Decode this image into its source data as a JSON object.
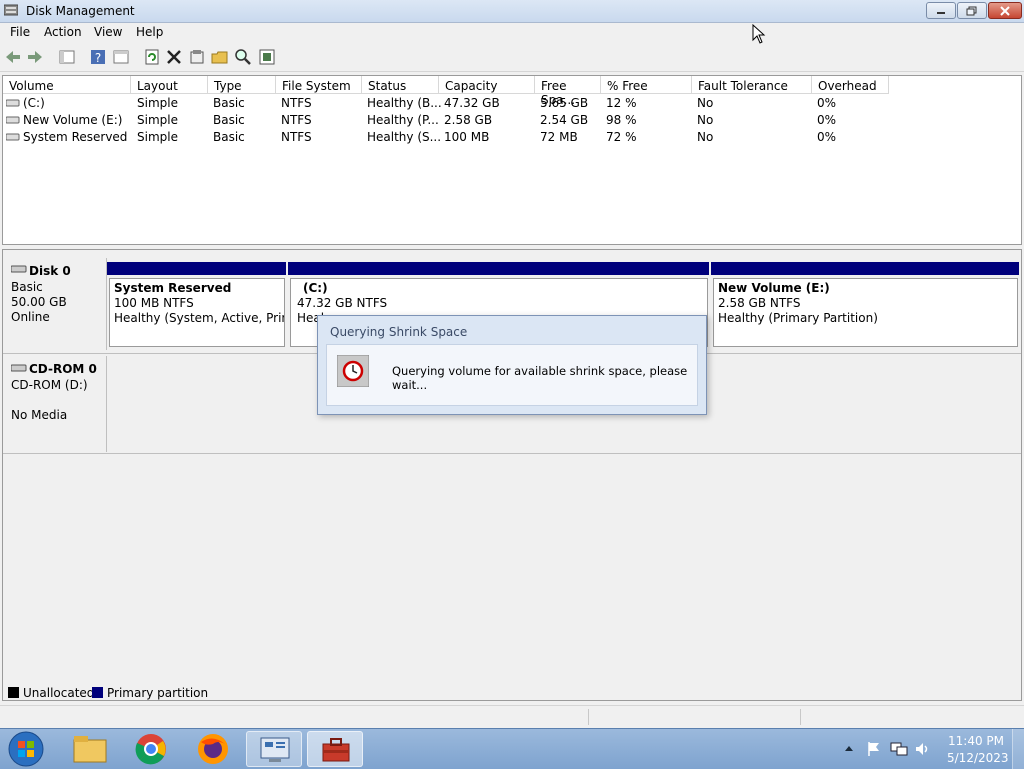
{
  "window": {
    "title": "Disk Management"
  },
  "menu": [
    "File",
    "Action",
    "View",
    "Help"
  ],
  "toolbar_icons": [
    "back-icon",
    "forward-icon",
    "console-icon",
    "help-icon",
    "properties-view-icon",
    "refresh-icon",
    "delete-icon",
    "properties-icon",
    "open-icon",
    "search-icon",
    "export-icon"
  ],
  "volume_table": {
    "columns": [
      "Volume",
      "Layout",
      "Type",
      "File System",
      "Status",
      "Capacity",
      "Free Spa...",
      "% Free",
      "Fault Tolerance",
      "Overhead"
    ],
    "rows": [
      [
        "(C:)",
        "Simple",
        "Basic",
        "NTFS",
        "Healthy (B...",
        "47.32 GB",
        "5.65 GB",
        "12 %",
        "No",
        "0%"
      ],
      [
        "New Volume (E:)",
        "Simple",
        "Basic",
        "NTFS",
        "Healthy (P...",
        "2.58 GB",
        "2.54 GB",
        "98 %",
        "No",
        "0%"
      ],
      [
        "System Reserved",
        "Simple",
        "Basic",
        "NTFS",
        "Healthy (S...",
        "100 MB",
        "72 MB",
        "72 %",
        "No",
        "0%"
      ]
    ]
  },
  "disks": {
    "disk0": {
      "name": "Disk 0",
      "type": "Basic",
      "size": "50.00 GB",
      "state": "Online"
    },
    "cdrom0": {
      "name": "CD-ROM 0",
      "drive": "CD-ROM (D:)",
      "media": "No Media"
    }
  },
  "partitions": [
    {
      "name": "System Reserved",
      "size": "100 MB NTFS",
      "status": "Healthy (System, Active, Primar"
    },
    {
      "name": "(C:)",
      "size": "47.32 GB NTFS",
      "status": "Heal"
    },
    {
      "name": "New Volume  (E:)",
      "size": "2.58 GB NTFS",
      "status": "Healthy (Primary Partition)"
    }
  ],
  "dialog": {
    "title": "Querying Shrink Space",
    "message": "Querying volume for available shrink space, please wait..."
  },
  "legend": {
    "unallocated": "Unallocated",
    "primary": "Primary partition"
  },
  "colors": {
    "primary_partition": "#00007b",
    "unallocated": "#000000"
  },
  "taskbar": {
    "apps": [
      "start-orb",
      "file-explorer-icon",
      "chrome-icon",
      "firefox-icon",
      "server-manager-icon",
      "computer-management-icon"
    ],
    "time": "11:40 PM",
    "date": "5/12/2023"
  }
}
